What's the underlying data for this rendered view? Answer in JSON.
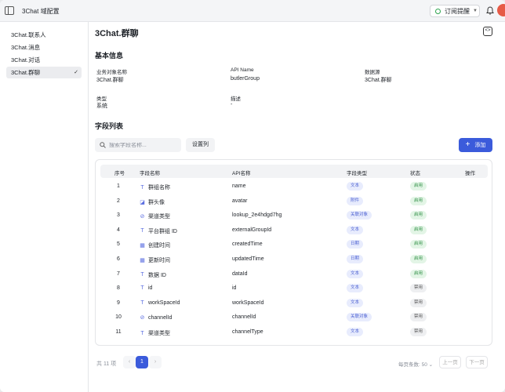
{
  "app": {
    "title": "3Chat 域配置"
  },
  "topbar": {
    "subscribe_label": "订阅提醒"
  },
  "nav": {
    "items": [
      {
        "label": "3Chat.联系人"
      },
      {
        "label": "3Chat.消息"
      },
      {
        "label": "3Chat.对话"
      },
      {
        "label": "3Chat.群聊",
        "active": true
      }
    ]
  },
  "page": {
    "title": "3Chat.群聊",
    "corner_label": "<>"
  },
  "basic": {
    "title": "基本信息",
    "fields": [
      {
        "label": "业务对象名称",
        "value": "3Chat.群聊"
      },
      {
        "label": "API Name",
        "value": "butlerGroup"
      },
      {
        "label": "数据源",
        "value": "3Chat.群聊"
      },
      {
        "label": "类型",
        "value": "系统"
      },
      {
        "label": "描述",
        "value": "-"
      }
    ]
  },
  "fields_section": {
    "title": "字段列表",
    "search_placeholder": "搜索字段名称...",
    "columns_button": "设置列",
    "add_button": "添加"
  },
  "table": {
    "headers": [
      "序号",
      "字段名称",
      "API名称",
      "字段类型",
      "状态",
      "操作"
    ],
    "rows": [
      {
        "no": "1",
        "icon": "T",
        "name": "群组名称",
        "api": "name",
        "type": "文本",
        "status": "启用",
        "on": true
      },
      {
        "no": "2",
        "icon": "◪",
        "name": "群头像",
        "api": "avatar",
        "type": "附件",
        "status": "启用",
        "on": true
      },
      {
        "no": "3",
        "icon": "⊘",
        "name": "渠道类型",
        "api": "lookup_2e4hdgd7hg",
        "type": "关联对象",
        "status": "启用",
        "on": true
      },
      {
        "no": "4",
        "icon": "T",
        "name": "平台群组 ID",
        "api": "externalGroupId",
        "type": "文本",
        "status": "启用",
        "on": true
      },
      {
        "no": "5",
        "icon": "▦",
        "name": "创建时间",
        "api": "createdTime",
        "type": "日期",
        "status": "启用",
        "on": true
      },
      {
        "no": "6",
        "icon": "▦",
        "name": "更新时间",
        "api": "updatedTime",
        "type": "日期",
        "status": "启用",
        "on": true
      },
      {
        "no": "7",
        "icon": "T",
        "name": "数据 ID",
        "api": "dataId",
        "type": "文本",
        "status": "启用",
        "on": true
      },
      {
        "no": "8",
        "icon": "T",
        "name": "id",
        "api": "id",
        "type": "文本",
        "status": "禁用",
        "on": false
      },
      {
        "no": "9",
        "icon": "T",
        "name": "workSpaceId",
        "api": "workSpaceId",
        "type": "文本",
        "status": "禁用",
        "on": false
      },
      {
        "no": "10",
        "icon": "⊘",
        "name": "channelId",
        "api": "channelId",
        "type": "关联对象",
        "status": "禁用",
        "on": false
      },
      {
        "no": "11",
        "icon": "T",
        "name": "渠道类型",
        "api": "channelType",
        "type": "文本",
        "status": "禁用",
        "on": false
      }
    ]
  },
  "pager": {
    "total": "共 11 项",
    "prev_arrow": "‹",
    "current": "1",
    "next_arrow": "›",
    "page_size": "每页条数: 50 ⌄",
    "prev_label": "上一页",
    "next_label": "下一页"
  },
  "colors": {
    "primary": "#3b5bdb",
    "enabled": "#2f8f46",
    "avatar": "#e65a46"
  }
}
